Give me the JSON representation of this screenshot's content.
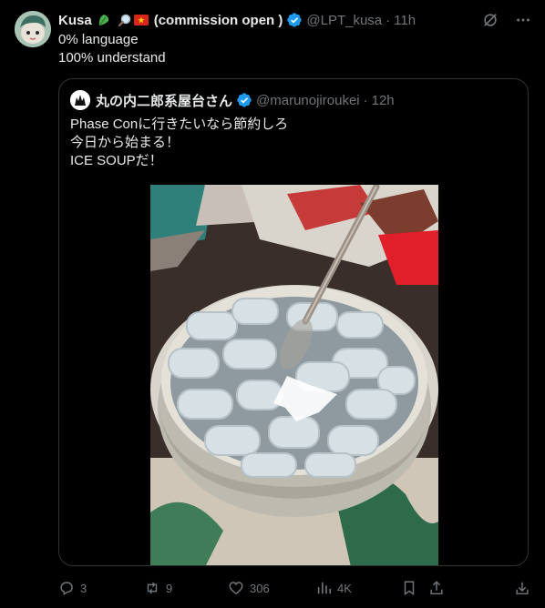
{
  "tweet": {
    "author_name": "Kusa",
    "author_badges": "commission open )",
    "badge_prefix": "(",
    "handle": "@LPT_kusa",
    "time": "11h",
    "lines": [
      "0% language",
      "100% understand"
    ]
  },
  "quote": {
    "author_name": "丸の内二郎系屋台さん",
    "handle": "@marunojiroukei",
    "time": "12h",
    "lines": [
      "Phase Conに行きたいなら節約しろ",
      "今日から始まる！",
      "ICE SOUPだ！"
    ],
    "media_icon": "bowl-of-ice-soup-photo"
  },
  "actions": {
    "replies": "3",
    "retweets": "9",
    "likes": "306",
    "views": "4K"
  },
  "colors": {
    "background": "#000000",
    "text": "#e7e9ea",
    "muted": "#71767b",
    "verified": "#1d9bf0",
    "border": "#2f3336"
  }
}
